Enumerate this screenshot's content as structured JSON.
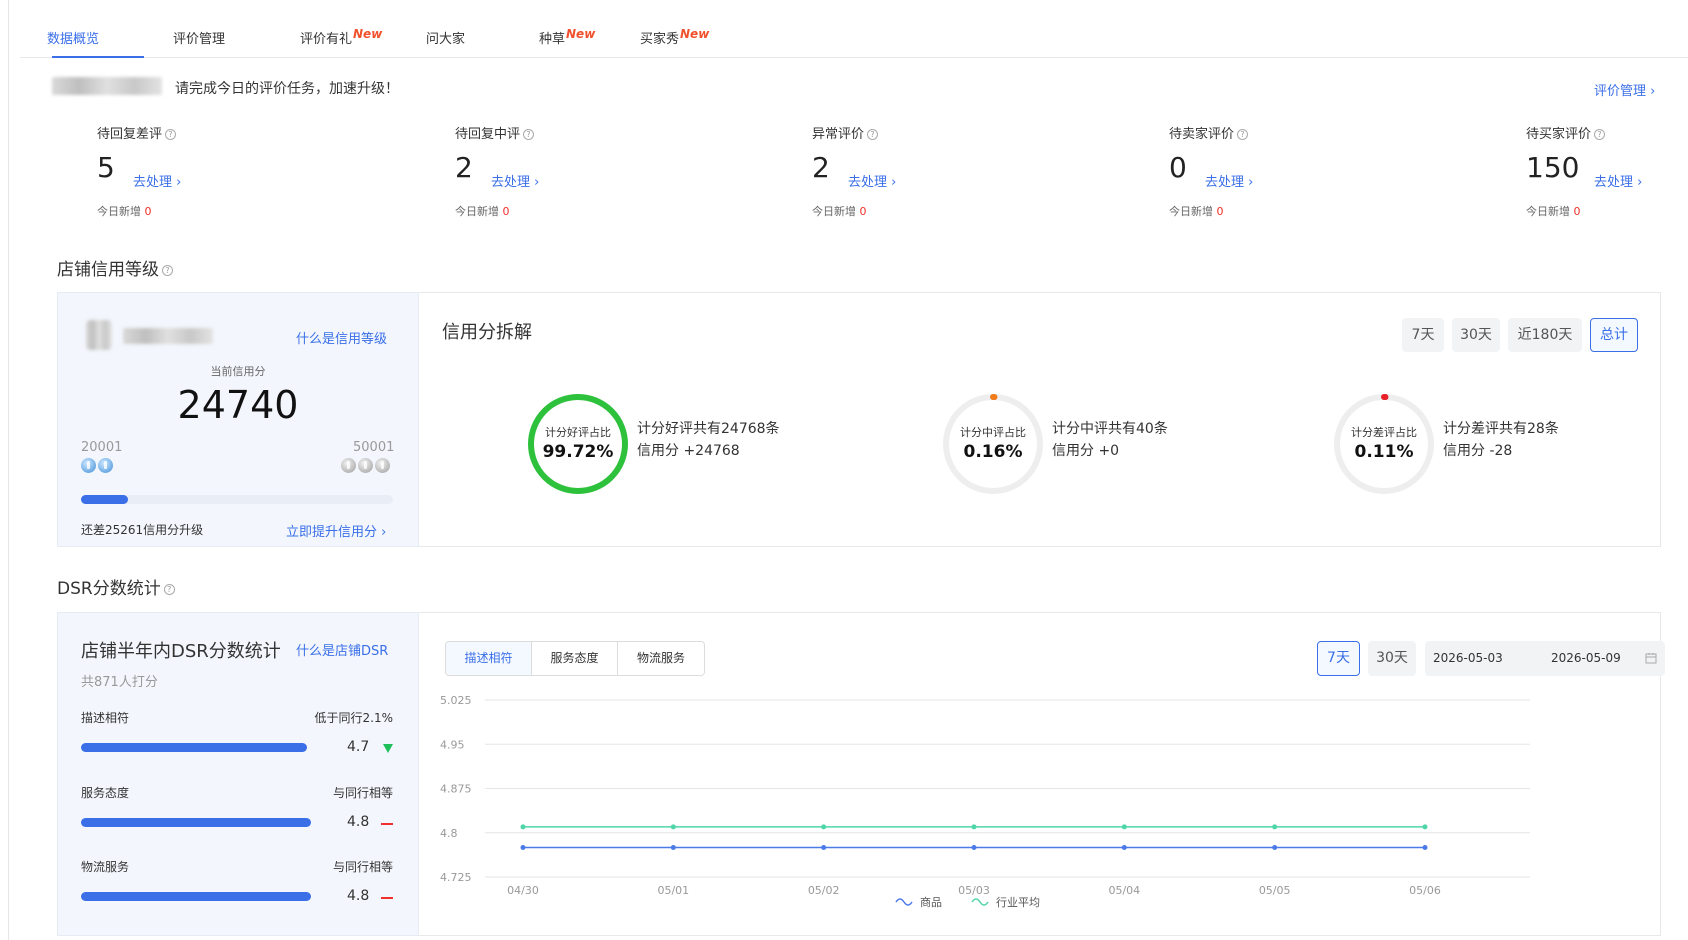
{
  "tabs": [
    {
      "label": "数据概览",
      "active": true,
      "new": ""
    },
    {
      "label": "评价管理",
      "active": false,
      "new": ""
    },
    {
      "label": "评价有礼",
      "active": false,
      "new": "New"
    },
    {
      "label": "问大家",
      "active": false,
      "new": ""
    },
    {
      "label": "种草",
      "active": false,
      "new": "New"
    },
    {
      "label": "买家秀",
      "active": false,
      "new": "New"
    }
  ],
  "banner": {
    "text": "请完成今日的评价任务，加速升级！",
    "manage_link": "评价管理 ›"
  },
  "stats": [
    {
      "label": "待回复差评",
      "value": "5",
      "action": "去处理 ›",
      "new_label": "今日新增",
      "new_value": "0"
    },
    {
      "label": "待回复中评",
      "value": "2",
      "action": "去处理 ›",
      "new_label": "今日新增",
      "new_value": "0"
    },
    {
      "label": "异常评价",
      "value": "2",
      "action": "去处理 ›",
      "new_label": "今日新增",
      "new_value": "0"
    },
    {
      "label": "待卖家评价",
      "value": "0",
      "action": "去处理 ›",
      "new_label": "今日新增",
      "new_value": "0"
    },
    {
      "label": "待买家评价",
      "value": "150",
      "action": "去处理 ›",
      "new_label": "今日新增",
      "new_value": "0"
    }
  ],
  "credit": {
    "section_title": "店铺信用等级",
    "what_link": "什么是信用等级",
    "current_label": "当前信用分",
    "current_value": "24740",
    "level_low": "20001",
    "level_high": "50001",
    "progress_fraction": 0.15,
    "gap_text": "还差25261信用分升级",
    "upgrade_link": "立即提升信用分 ›"
  },
  "breakdown": {
    "title": "信用分拆解",
    "periods": [
      "7天",
      "30天",
      "近180天",
      "总计"
    ],
    "active_period": "总计",
    "items": [
      {
        "ring_label": "计分好评占比",
        "pct": "99.72%",
        "fraction": 0.9972,
        "color": "#2ec23c",
        "line1": "计分好评共有24768条",
        "line2": "信用分 +24768"
      },
      {
        "ring_label": "计分中评占比",
        "pct": "0.16%",
        "fraction": 0.0016,
        "color": "#f07c1c",
        "line1": "计分中评共有40条",
        "line2": "信用分 +0"
      },
      {
        "ring_label": "计分差评占比",
        "pct": "0.11%",
        "fraction": 0.0011,
        "color": "#e8202a",
        "line1": "计分差评共有28条",
        "line2": "信用分 -28"
      }
    ]
  },
  "dsr": {
    "section_title": "DSR分数统计",
    "card_title": "店铺半年内DSR分数统计",
    "what_link": "什么是店铺DSR",
    "raters": "共871人打分",
    "rows": [
      {
        "label": "描述相符",
        "compare": "低于同行2.1%",
        "score": "4.7",
        "fraction": 0.94,
        "trend": "down"
      },
      {
        "label": "服务态度",
        "compare": "与同行相等",
        "score": "4.8",
        "fraction": 0.96,
        "trend": "equal"
      },
      {
        "label": "物流服务",
        "compare": "与同行相等",
        "score": "4.8",
        "fraction": 0.96,
        "trend": "equal"
      }
    ],
    "tabs": [
      "描述相符",
      "服务态度",
      "物流服务"
    ],
    "active_tab": "描述相符",
    "periods": [
      "7天",
      "30天"
    ],
    "active_period": "7天",
    "date_start": "2026-05-03",
    "date_end": "2026-05-09",
    "calendar_icon": "calendar-icon"
  },
  "colors": {
    "accent": "#3a6fe8",
    "good": "#2ec23c",
    "mid": "#f07c1c",
    "bad": "#e8202a",
    "industry": "#4fd6a8"
  },
  "chart_data": {
    "type": "line",
    "x": [
      "04/30",
      "05/01",
      "05/02",
      "05/03",
      "05/04",
      "05/05",
      "05/06"
    ],
    "series": [
      {
        "name": "商品",
        "values": [
          4.775,
          4.775,
          4.775,
          4.775,
          4.775,
          4.775,
          4.775
        ],
        "color": "#4a7be8"
      },
      {
        "name": "行业平均",
        "values": [
          4.81,
          4.81,
          4.81,
          4.81,
          4.81,
          4.81,
          4.81
        ],
        "color": "#4fd6a8"
      }
    ],
    "yticks": [
      "5.025",
      "4.95",
      "4.875",
      "4.8",
      "4.725"
    ],
    "ylim": [
      4.725,
      5.025
    ],
    "grid": true,
    "legend": "bottom"
  }
}
